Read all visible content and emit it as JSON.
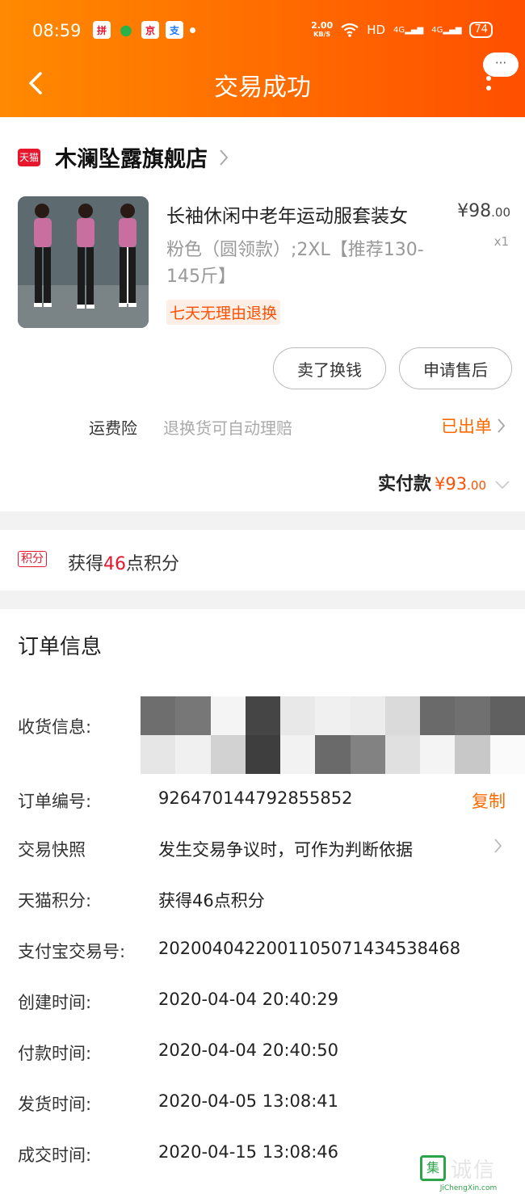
{
  "status_bar": {
    "time": "08:59",
    "net_speed_value": "2.00",
    "net_speed_unit": "KB/S",
    "hd": "HD",
    "signal1": "4G",
    "signal2": "4G",
    "battery": "74"
  },
  "header": {
    "title": "交易成功",
    "bubble": "···"
  },
  "shop": {
    "tag": "天猫",
    "name": "木澜坠露旗舰店"
  },
  "product": {
    "title": "长袖休闲中老年运动服套装女",
    "price_main": "¥98",
    "price_decimal": ".00",
    "quantity": "x1",
    "sku": "粉色（圆领款）;2XL【推荐130-145斤】",
    "return_tag": "七天无理由退换"
  },
  "actions": {
    "sell": "卖了换钱",
    "after_sale": "申请售后"
  },
  "insurance": {
    "label": "运费险",
    "text": "退换货可自动理赔",
    "status": "已出单"
  },
  "payment": {
    "label": "实付款",
    "amount_main": "¥93",
    "amount_decimal": ".00"
  },
  "points": {
    "tag": "积分",
    "prefix": "获得",
    "number": "46",
    "suffix": "点积分"
  },
  "order_info": {
    "title": "订单信息",
    "shipping_label": "收货信息:",
    "order_no_label": "订单编号:",
    "order_no": "926470144792855852",
    "copy": "复制",
    "snapshot_label": "交易快照",
    "snapshot_value": "发生交易争议时，可作为判断依据",
    "tmall_points_label": "天猫积分:",
    "tmall_points_value": "获得46点积分",
    "alipay_label": "支付宝交易号:",
    "alipay_value": "2020040422001105071434538468",
    "created_label": "创建时间:",
    "created_value": "2020-04-04 20:40:29",
    "paid_label": "付款时间:",
    "paid_value": "2020-04-04 20:40:50",
    "shipped_label": "发货时间:",
    "shipped_value": "2020-04-05 13:08:41",
    "closed_label": "成交时间:",
    "closed_value": "2020-04-15 13:08:46"
  },
  "watermark": {
    "box": "集",
    "cn": "诚信",
    "en": "JiChengXin.com"
  },
  "colors": {
    "header_start": "#ff8a00",
    "header_end": "#ff4f00",
    "accent": "#ff6a00",
    "tmall_red": "#e6162d"
  }
}
